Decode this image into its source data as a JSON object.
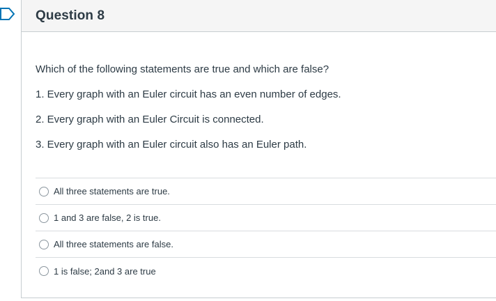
{
  "question": {
    "title": "Question 8",
    "stem": [
      "Which of the following statements are true and which are false?",
      "1. Every graph with an Euler circuit has an even number of edges.",
      "2. Every graph with an Euler Circuit is connected.",
      "3. Every graph with an Euler circuit also has an Euler path."
    ],
    "answers": [
      "All three statements are true.",
      "1 and 3 are false, 2 is true.",
      "All three statements are false.",
      "1 is false; 2and 3 are true"
    ]
  },
  "icons": {
    "flag": "bookmark-flag-icon"
  },
  "colors": {
    "accent": "#0374b5",
    "text": "#2d3b45",
    "header_bg": "#f5f5f5",
    "border": "#c7cdd1"
  }
}
